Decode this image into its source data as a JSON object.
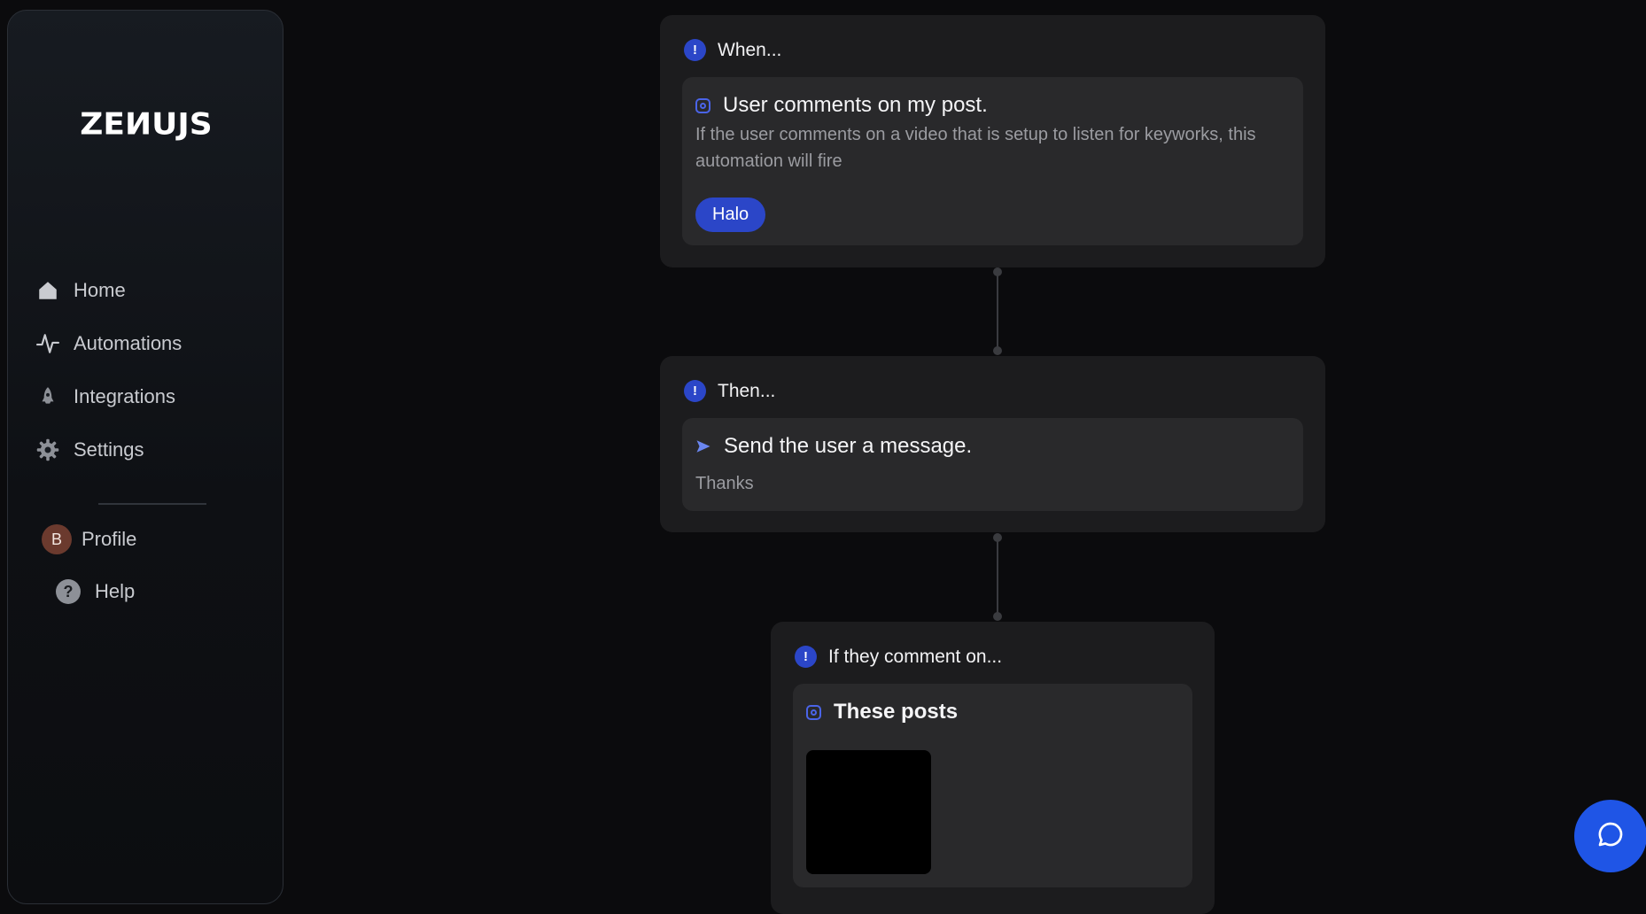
{
  "sidebar": {
    "logo": "ZEИUJS",
    "nav": [
      {
        "label": "Home",
        "icon": "home-icon"
      },
      {
        "label": "Automations",
        "icon": "activity-icon"
      },
      {
        "label": "Integrations",
        "icon": "rocket-icon"
      },
      {
        "label": "Settings",
        "icon": "gear-icon"
      }
    ],
    "profile": {
      "initial": "B",
      "label": "Profile"
    },
    "help": {
      "label": "Help"
    }
  },
  "flow": {
    "trigger": {
      "heading": "When...",
      "title": "User comments on my post.",
      "description": "If the user comments on a video that is setup to listen for keyworks, this automation will fire",
      "keyword": "Halo"
    },
    "action": {
      "heading": "Then...",
      "title": "Send the user a message.",
      "message": "Thanks"
    },
    "posts": {
      "heading": "If they comment on...",
      "title": "These posts"
    }
  },
  "colors": {
    "accent": "#2b46c8",
    "chat_button": "#1f55e6",
    "card": "#1c1c1e",
    "inner": "#29292b"
  },
  "chat": {
    "icon": "chat-bubble-icon"
  }
}
